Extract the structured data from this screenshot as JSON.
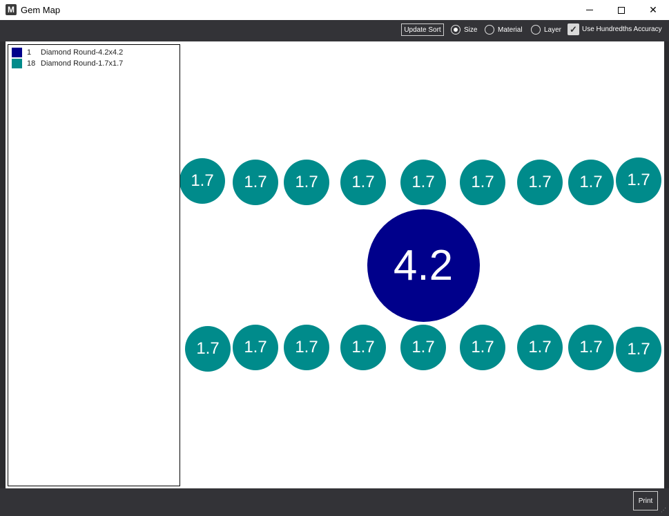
{
  "window": {
    "title": "Gem Map",
    "icon_letter": "M",
    "minimize_icon": "minimize-icon",
    "maximize_icon": "maximize-icon",
    "close_icon": "close-icon",
    "close_glyph": "✕"
  },
  "toolbar": {
    "update_sort_label": "Update Sort",
    "sort_options": [
      {
        "label": "Size",
        "checked": true
      },
      {
        "label": "Material",
        "checked": false
      },
      {
        "label": "Layer",
        "checked": false
      }
    ],
    "hundredths_label": "Use Hundredths Accuracy",
    "hundredths_checked": true,
    "check_glyph": "✓"
  },
  "legend": {
    "items": [
      {
        "count": "1",
        "name": "Diamond Round-4.2x4.2",
        "color": "#00008b"
      },
      {
        "count": "18",
        "name": "Diamond Round-1.7x1.7",
        "color": "#008b8b"
      }
    ]
  },
  "gems": {
    "large": {
      "label": "4.2",
      "color": "#00008b",
      "size_mm": 4.2
    },
    "small_color": "#008b8b",
    "small_size_mm": 1.7,
    "top_row": [
      "1.7",
      "1.7",
      "1.7",
      "1.7",
      "1.7",
      "1.7",
      "1.7",
      "1.7",
      "1.7"
    ],
    "bottom_row": [
      "1.7",
      "1.7",
      "1.7",
      "1.7",
      "1.7",
      "1.7",
      "1.7",
      "1.7",
      "1.7"
    ]
  },
  "bottom": {
    "print_label": "Print"
  }
}
